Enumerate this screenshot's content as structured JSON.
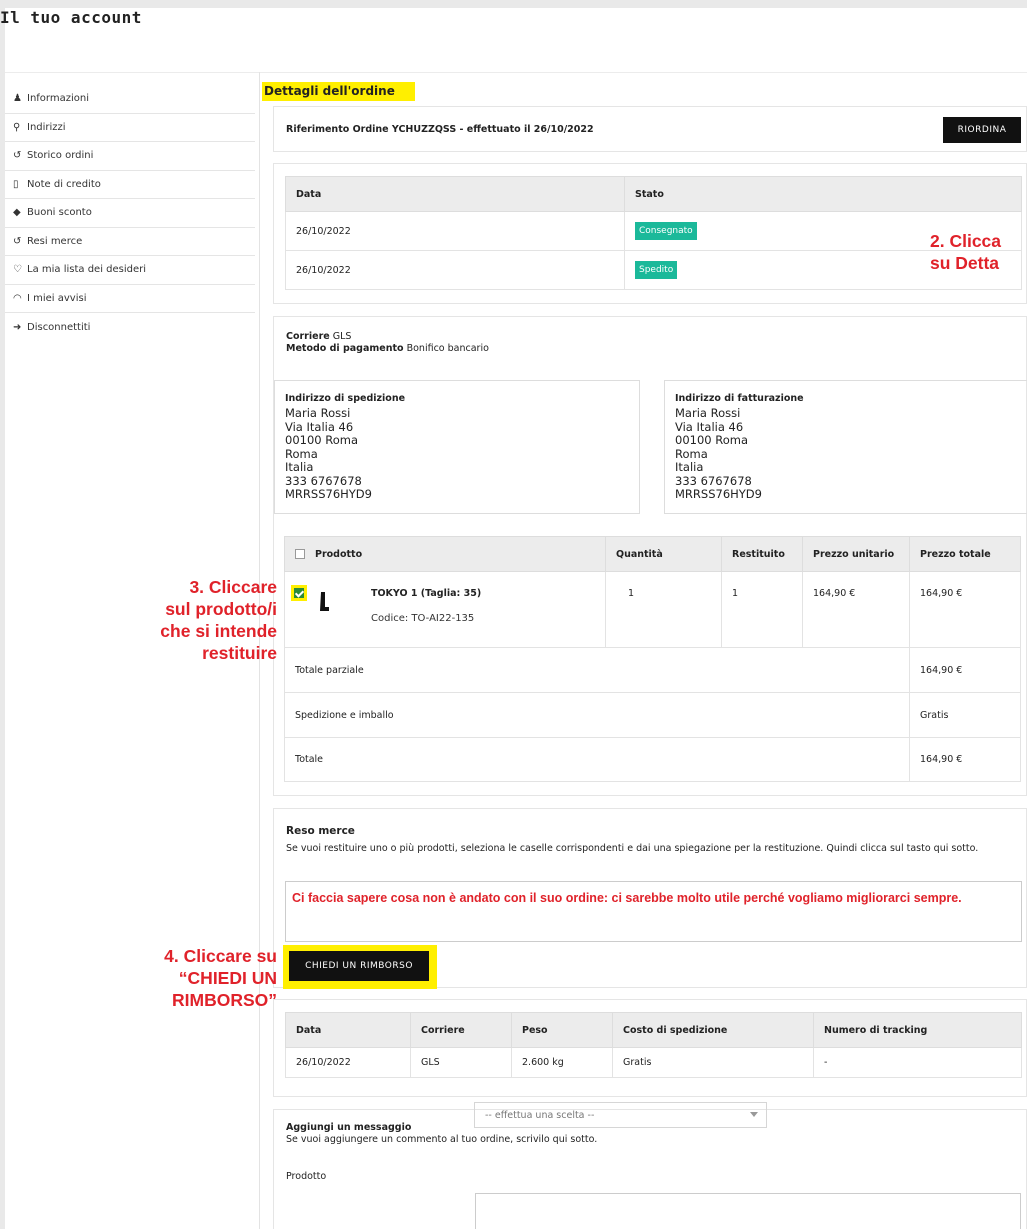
{
  "header": {
    "title": "Il tuo account"
  },
  "sidebar": {
    "items": [
      {
        "icon": "user-icon",
        "glyph": "♟",
        "label": "Informazioni"
      },
      {
        "icon": "map-pin-icon",
        "glyph": "⚲",
        "label": "Indirizzi"
      },
      {
        "icon": "history-icon",
        "glyph": "↺",
        "label": "Storico ordini"
      },
      {
        "icon": "document-icon",
        "glyph": "▯",
        "label": "Note di credito"
      },
      {
        "icon": "tag-icon",
        "glyph": "◆",
        "label": "Buoni sconto"
      },
      {
        "icon": "return-icon",
        "glyph": "↺",
        "label": "Resi merce"
      },
      {
        "icon": "heart-icon",
        "glyph": "♡",
        "label": "La mia lista dei desideri"
      },
      {
        "icon": "bell-icon",
        "glyph": "◠",
        "label": "I miei avvisi"
      },
      {
        "icon": "logout-icon",
        "glyph": "➜",
        "label": "Disconnettiti"
      }
    ]
  },
  "order": {
    "section_title": "Dettagli dell'ordine",
    "reference": "Riferimento Ordine YCHUZZQSS - effettuato il 26/10/2022",
    "reorder_label": "RIORDINA",
    "status_table": {
      "headers": [
        "Data",
        "Stato"
      ],
      "rows": [
        {
          "date": "26/10/2022",
          "status": "Consegnato"
        },
        {
          "date": "26/10/2022",
          "status": "Spedito"
        }
      ]
    },
    "carrier_label": "Corriere",
    "carrier": "GLS",
    "payment_label": "Metodo di pagamento",
    "payment": "Bonifico bancario",
    "shipping_address": {
      "title": "Indirizzo di spedizione",
      "lines": [
        "Maria Rossi",
        "Via Italia 46",
        "00100 Roma",
        "Roma",
        "Italia",
        "333 6767678",
        "MRRSS76HYD9"
      ]
    },
    "billing_address": {
      "title": "Indirizzo di fatturazione",
      "lines": [
        "Maria Rossi",
        "Via Italia 46",
        "00100 Roma",
        "Roma",
        "Italia",
        "333 6767678",
        "MRRSS76HYD9"
      ]
    },
    "products_table": {
      "headers": [
        "Prodotto",
        "Quantità",
        "Restituito",
        "Prezzo unitario",
        "Prezzo totale"
      ],
      "product": {
        "name": "TOKYO 1 (Taglia: 35)",
        "code": "Codice: TO-AI22-135",
        "quantity": "1",
        "returned": "1",
        "unit_price": "164,90 €",
        "total_price": "164,90 €",
        "checked": true
      },
      "subtotal_label": "Totale parziale",
      "subtotal": "164,90 €",
      "shipping_label": "Spedizione e imballo",
      "shipping": "Gratis",
      "total_label": "Totale",
      "total": "164,90 €"
    },
    "return": {
      "title": "Reso merce",
      "description": "Se vuoi restituire uno o più prodotti, seleziona le caselle corrispondenti e dai una spiegazione per la restituzione. Quindi clicca sul tasto qui sotto.",
      "textarea_value": "Ci faccia sapere cosa non è andato con il suo ordine: ci sarebbe molto utile perché vogliamo migliorarci sempre.",
      "button_label": "CHIEDI UN RIMBORSO"
    },
    "shipment_table": {
      "headers": [
        "Data",
        "Corriere",
        "Peso",
        "Costo di spedizione",
        "Numero di tracking"
      ],
      "row": [
        "26/10/2022",
        "GLS",
        "2.600 kg",
        "Gratis",
        "-"
      ]
    },
    "message": {
      "title": "Aggiungi un messaggio",
      "description": "Se vuoi aggiungere un commento al tuo ordine, scrivilo qui sotto.",
      "product_label": "Prodotto",
      "select_placeholder": "-- effettua una scelta --"
    }
  },
  "annotations": {
    "step2_line1": "2. Clicca",
    "step2_line2": "su Detta",
    "step3": [
      "3. Cliccare",
      "sul prodotto/i",
      "che si intende",
      "restituire"
    ],
    "step4": [
      "4. Cliccare su",
      "“CHIEDI UN",
      "RIMBORSO”"
    ]
  },
  "colors": {
    "highlight": "#ffef00",
    "badge": "#1bb99a",
    "annotation": "#e0222a",
    "button": "#111111"
  }
}
